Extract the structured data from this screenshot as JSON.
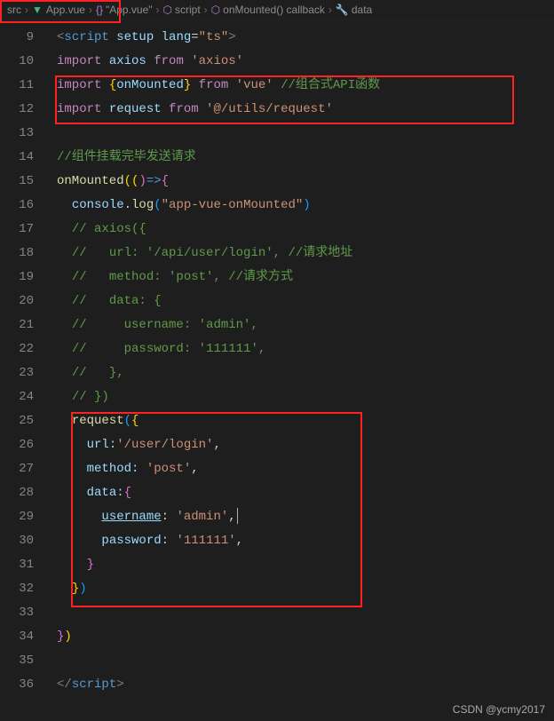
{
  "breadcrumb": {
    "items": [
      {
        "label": "src",
        "icon": ""
      },
      {
        "label": "App.vue",
        "icon": "vue"
      },
      {
        "label": "\"App.vue\"",
        "icon": "brace"
      },
      {
        "label": "script",
        "icon": "cube"
      },
      {
        "label": "onMounted() callback",
        "icon": "cube"
      },
      {
        "label": "data",
        "icon": "wrench"
      }
    ]
  },
  "gutter": {
    "start": 9,
    "end": 36
  },
  "code": {
    "l9": {
      "p1": "<",
      "p2": "script",
      "p3": " setup",
      "p4": " lang",
      "p5": "=",
      "p6": "\"ts\"",
      "p7": ">"
    },
    "l10": {
      "p1": "import",
      "p2": " axios ",
      "p3": "from",
      "p4": " 'axios'"
    },
    "l11": {
      "p1": "import",
      "p2": " {",
      "p3": "onMounted",
      "p4": "} ",
      "p5": "from",
      "p6": " 'vue'",
      "p7": " //组合式API函数"
    },
    "l12": {
      "p1": "import",
      "p2": " request ",
      "p3": "from",
      "p4": " '@/utils/request'"
    },
    "l14": {
      "p1": "//组件挂载完毕发送请求"
    },
    "l15": {
      "p1": "onMounted",
      "p2": "((",
      "p3": ")",
      "p4": "=>",
      "p5": "{"
    },
    "l16": {
      "p1": "console",
      "p2": ".",
      "p3": "log",
      "p4": "(",
      "p5": "\"app-vue-onMounted\"",
      "p6": ")"
    },
    "l17": {
      "p1": "// axios({"
    },
    "l18": {
      "p1": "//   url: '/api/user/login', //请求地址"
    },
    "l19": {
      "p1": "//   method: 'post', //请求方式"
    },
    "l20": {
      "p1": "//   data: {"
    },
    "l21": {
      "p1": "//     username: 'admin',"
    },
    "l22": {
      "p1": "//     password: '111111',"
    },
    "l23": {
      "p1": "//   },"
    },
    "l24": {
      "p1": "// })"
    },
    "l25": {
      "p1": "request",
      "p2": "(",
      "p3": "{"
    },
    "l26": {
      "p1": "url:",
      "p2": "'/user/login'",
      "p3": ","
    },
    "l27": {
      "p1": "method:",
      "p2": " 'post'",
      "p3": ","
    },
    "l28": {
      "p1": "data:",
      "p2": "{"
    },
    "l29": {
      "p1": "username",
      "p2": ":",
      "p3": " 'admin'",
      "p4": ","
    },
    "l30": {
      "p1": "password:",
      "p2": " '111111'",
      "p3": ","
    },
    "l31": {
      "p1": "}"
    },
    "l32": {
      "p1": "}",
      "p2": ")"
    },
    "l34": {
      "p1": "}",
      "p2": ")"
    },
    "l36": {
      "p1": "</",
      "p2": "script",
      "p3": ">"
    }
  },
  "watermark": "CSDN @ycmy2017"
}
